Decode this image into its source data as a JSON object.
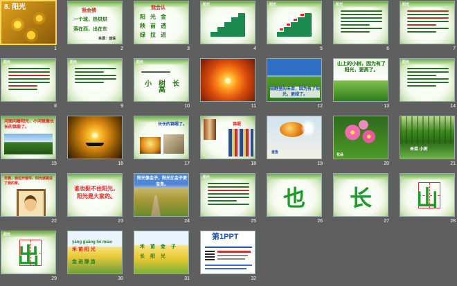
{
  "slides": [
    {
      "num": "1",
      "title": "8. 阳光"
    },
    {
      "num": "2",
      "title": "我会猜",
      "lines": [
        "一个球，热烘烘",
        "落在西，出在东"
      ],
      "source": "来源：谜语"
    },
    {
      "num": "3",
      "title": "我会认",
      "chars": [
        "阳",
        "光",
        "金",
        "秧",
        "苗",
        "透",
        "绿",
        "拉",
        "进"
      ]
    },
    {
      "num": "4",
      "title": "阳光"
    },
    {
      "num": "5",
      "title": "阳光"
    },
    {
      "num": "6",
      "title": "阳光"
    },
    {
      "num": "7",
      "title": "阳光"
    },
    {
      "num": "8",
      "title": "阳光"
    },
    {
      "num": "9",
      "title": "阳光"
    },
    {
      "num": "10",
      "title": "阳光"
    },
    {
      "num": "11",
      "title": ""
    },
    {
      "num": "12",
      "caption": "田野里的禾苗，因为有了阳光，更绿了。"
    },
    {
      "num": "13",
      "caption": "山上的小树，因为有了阳光，更高了。"
    },
    {
      "num": "14",
      "title": "阳光"
    },
    {
      "num": "15",
      "caption": "河面闪着阳光，小河就像长长的锦缎了。"
    },
    {
      "num": "16",
      "caption": ""
    },
    {
      "num": "17",
      "caption": "长长的锦缎了。"
    },
    {
      "num": "18",
      "caption": "锦缎"
    },
    {
      "num": "19",
      "caption": "金鱼"
    },
    {
      "num": "20",
      "caption": "花朵"
    },
    {
      "num": "21",
      "caption": "禾苗 小树"
    },
    {
      "num": "22",
      "caption": "早晨，我拉开窗帘，阳光就跳进了我的家。"
    },
    {
      "num": "23",
      "caption": "谁也捉不住阳光，阳光是大家的。"
    },
    {
      "num": "24",
      "caption": "阳光像金子，阳光比金子更宝贵。"
    },
    {
      "num": "25",
      "title": "阳光"
    },
    {
      "num": "26",
      "char": "也"
    },
    {
      "num": "27",
      "char": "长"
    },
    {
      "num": "28",
      "char": "山"
    },
    {
      "num": "29",
      "char": "出",
      "title": "阳光"
    },
    {
      "num": "30",
      "lines": [
        "禾 苗 阳 光",
        "yáng guāng hé miáo",
        "金 进 静 苗"
      ]
    },
    {
      "num": "31",
      "lines": [
        "禾 苗 金 子",
        "长 阳 光"
      ]
    },
    {
      "num": "32",
      "brand": "第1PPT"
    }
  ],
  "colors": {
    "background": "#5f5f5f",
    "green": "#1f9a2c",
    "red": "#d22222",
    "selected": "#ffd75a"
  }
}
